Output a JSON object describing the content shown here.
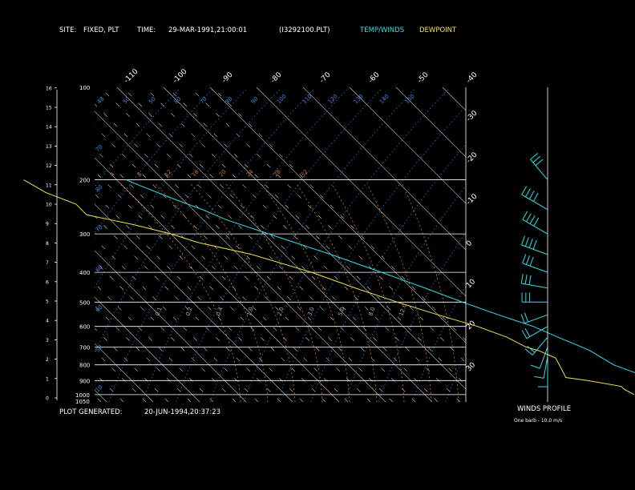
{
  "header": {
    "site_label": "SITE:",
    "site_value": "FIXED, PLT",
    "time_label": "TIME:",
    "time_value": "29-MAR-1991,21:00:01",
    "file_name": "(I3292100.PLT)",
    "legend_temp": "TEMP/WINDS",
    "legend_dew": "DEWPOINT"
  },
  "footer": {
    "generated_label": "PLOT GENERATED:",
    "generated_value": "20-JUN-1994,20:37:23",
    "winds_title": "WINDS PROFILE",
    "barb_note": "One barb - 10.0 m/s"
  },
  "colors": {
    "background": "#000000",
    "temp": "#33e0e6",
    "dewpoint": "#f0e050",
    "isotherm": "#d0d0d0",
    "dry_adiabat": "#d0d0d0",
    "moist_adiabat": "#3a78d8",
    "mixing_ratio": "#c87a3a",
    "isobar": "#ffffff",
    "moist_label": "#4a88e8",
    "mix_label": "#c87a3a"
  },
  "chart_data": {
    "type": "skew-t log-p",
    "pressure_levels_hpa": [
      100,
      200,
      300,
      400,
      500,
      600,
      700,
      800,
      900,
      1000,
      1050
    ],
    "pressure_tick_labels": [
      "100",
      "200",
      "300",
      "400",
      "500",
      "600",
      "700",
      "800",
      "900",
      "1000",
      "1050"
    ],
    "height_km_ticks": [
      0,
      1,
      2,
      3,
      4,
      5,
      6,
      7,
      8,
      9,
      10,
      11,
      12,
      13,
      14,
      15,
      16
    ],
    "isotherm_top_labels": [
      "-110",
      "-100",
      "-90",
      "-80",
      "-70",
      "-60",
      "-50",
      "-40"
    ],
    "isotherm_right_labels": [
      "-30",
      "-20",
      "-10",
      "0",
      "10",
      "20",
      "30"
    ],
    "moist_adiabat_labels": [
      "48",
      "50",
      "50",
      "80",
      "70",
      "80",
      "90",
      "100",
      "110",
      "120",
      "130",
      "140",
      "150",
      "160"
    ],
    "moist_left_labels": [
      "70",
      "80",
      "70",
      "60",
      "60",
      "50",
      "10"
    ],
    "mixing_ratio_top_labels": [
      "4",
      "8",
      "12",
      "16",
      "20",
      "24",
      "28",
      "32"
    ],
    "mixing_ratio_mid_labels": [
      "0.1",
      "0.2",
      "0.4",
      "1.0",
      "2.0",
      "3.0",
      "5.0",
      "8.0",
      "12.0"
    ],
    "temperature_profile": [
      {
        "p": 1000,
        "t": 21
      },
      {
        "p": 925,
        "t": 15
      },
      {
        "p": 850,
        "t": 10
      },
      {
        "p": 800,
        "t": 7
      },
      {
        "p": 760,
        "t": 6
      },
      {
        "p": 720,
        "t": 5
      },
      {
        "p": 700,
        "t": 4
      },
      {
        "p": 650,
        "t": 1
      },
      {
        "p": 600,
        "t": -2
      },
      {
        "p": 550,
        "t": -7
      },
      {
        "p": 500,
        "t": -12
      },
      {
        "p": 450,
        "t": -17
      },
      {
        "p": 400,
        "t": -23
      },
      {
        "p": 350,
        "t": -30
      },
      {
        "p": 300,
        "t": -39
      },
      {
        "p": 270,
        "t": -45
      },
      {
        "p": 250,
        "t": -48
      },
      {
        "p": 230,
        "t": -52
      },
      {
        "p": 210,
        "t": -56
      },
      {
        "p": 200,
        "t": -58
      }
    ],
    "dewpoint_profile": [
      {
        "p": 1000,
        "td": 5
      },
      {
        "p": 960,
        "td": 4
      },
      {
        "p": 940,
        "td": 4
      },
      {
        "p": 900,
        "td": -2
      },
      {
        "p": 880,
        "td": -6
      },
      {
        "p": 820,
        "td": -5
      },
      {
        "p": 760,
        "td": -4
      },
      {
        "p": 720,
        "td": -6
      },
      {
        "p": 700,
        "td": -8
      },
      {
        "p": 650,
        "td": -10
      },
      {
        "p": 600,
        "td": -14
      },
      {
        "p": 550,
        "td": -20
      },
      {
        "p": 500,
        "td": -26
      },
      {
        "p": 450,
        "td": -32
      },
      {
        "p": 400,
        "td": -38
      },
      {
        "p": 350,
        "td": -47
      },
      {
        "p": 320,
        "td": -56
      },
      {
        "p": 300,
        "td": -60
      },
      {
        "p": 280,
        "td": -66
      },
      {
        "p": 260,
        "td": -74
      },
      {
        "p": 240,
        "td": -74
      },
      {
        "p": 220,
        "td": -78
      },
      {
        "p": 200,
        "td": -80
      }
    ],
    "winds_profile": [
      {
        "p": 200,
        "dir": 320,
        "spd": 30
      },
      {
        "p": 250,
        "dir": 300,
        "spd": 45
      },
      {
        "p": 300,
        "dir": 300,
        "spd": 40
      },
      {
        "p": 350,
        "dir": 290,
        "spd": 35
      },
      {
        "p": 400,
        "dir": 290,
        "spd": 30
      },
      {
        "p": 450,
        "dir": 280,
        "spd": 30
      },
      {
        "p": 500,
        "dir": 270,
        "spd": 25
      },
      {
        "p": 550,
        "dir": 250,
        "spd": 20
      },
      {
        "p": 600,
        "dir": 240,
        "spd": 18
      },
      {
        "p": 650,
        "dir": 220,
        "spd": 15
      },
      {
        "p": 700,
        "dir": 200,
        "spd": 12
      },
      {
        "p": 750,
        "dir": 190,
        "spd": 10
      },
      {
        "p": 800,
        "dir": 180,
        "spd": 8
      }
    ],
    "grid": true,
    "legend": "top-right"
  }
}
